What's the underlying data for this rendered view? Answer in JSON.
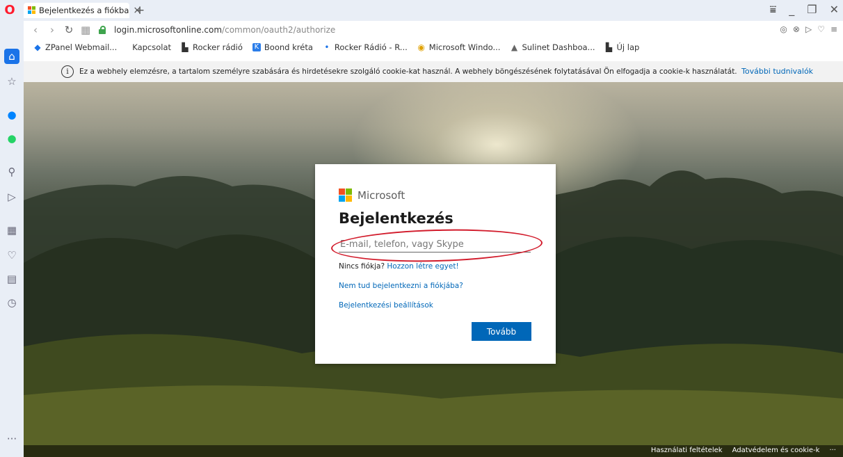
{
  "browser": {
    "tab_title": "Bejelentkezés a fiókba",
    "tab_close": "×",
    "new_tab": "+",
    "url_host": "login.microsoftonline.com",
    "url_path": "/common/oauth2/authorize",
    "window_controls": [
      "menu-icon",
      "minimize-icon",
      "restore-icon",
      "close-icon"
    ]
  },
  "bookmarks": [
    {
      "label": "ZPanel Webmail...",
      "icon": "zpanel-icon",
      "color": "#1a73e8"
    },
    {
      "label": "Kapcsolat",
      "icon": "",
      "color": ""
    },
    {
      "label": "Rocker rádió",
      "icon": "file-icon",
      "color": "#333333"
    },
    {
      "label": "Boond kréta",
      "icon": "k-icon",
      "color": "#2b7de9"
    },
    {
      "label": "Rocker Rádió - R...",
      "icon": "dot-icon",
      "color": "#1a73e8"
    },
    {
      "label": "Microsoft Windo...",
      "icon": "linux-icon",
      "color": "#e0a100"
    },
    {
      "label": "Sulinet Dashboa...",
      "icon": "sulinet-icon",
      "color": "#666666"
    },
    {
      "label": "Új lap",
      "icon": "file-icon",
      "color": "#333333"
    }
  ],
  "sidebar_icons": [
    "home-icon",
    "star-icon",
    "messenger-icon",
    "whatsapp-icon",
    "search-icon",
    "send-icon",
    "grid-icon",
    "heart-icon",
    "news-icon",
    "history-icon",
    "more-icon"
  ],
  "cookie_banner": {
    "text": "Ez a webhely elemzésre, a tartalom személyre szabására és hirdetésekre szolgáló cookie-kat használ. A webhely böngészésének folytatásával Ön elfogadja a cookie-k használatát.",
    "link": "További tudnivalók"
  },
  "signin": {
    "brand": "Microsoft",
    "title": "Bejelentkezés",
    "email_placeholder": "E-mail, telefon, vagy Skype",
    "no_account_text": "Nincs fiókja?",
    "create_link": "Hozzon létre egyet!",
    "cant_access_link": "Nem tud bejelentkezni a fiókjába?",
    "signin_options_link": "Bejelentkezési beállítások",
    "next_button": "Tovább",
    "logo_colors": [
      "#f25022",
      "#7fba00",
      "#00a4ef",
      "#ffb900"
    ]
  },
  "footer": {
    "terms": "Használati feltételek",
    "privacy": "Adatvédelem és cookie-k",
    "more": "···"
  }
}
